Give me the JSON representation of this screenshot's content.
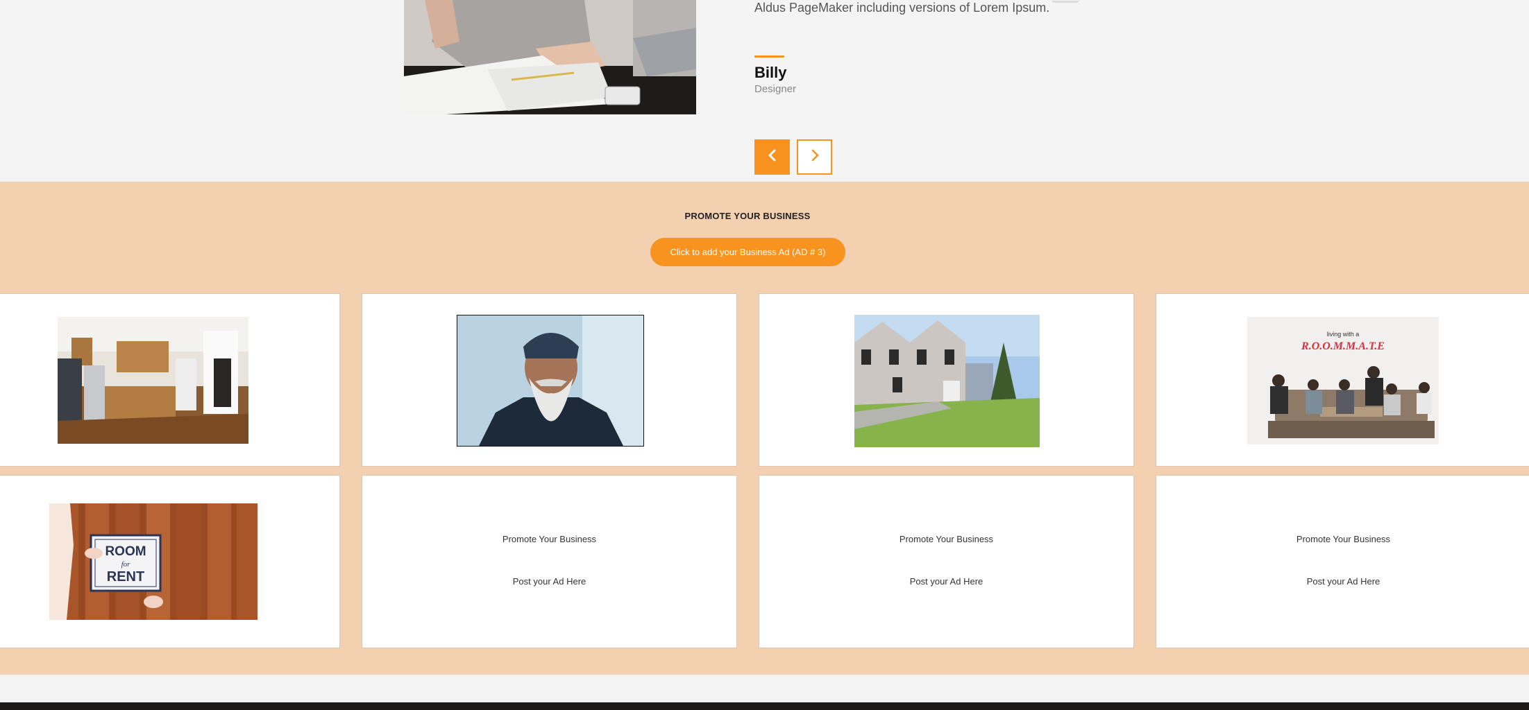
{
  "testimonial": {
    "quote": "Aldus PageMaker including versions of Lorem Ipsum.",
    "name": "Billy",
    "role": "Designer"
  },
  "promo": {
    "title": "PROMOTE YOUR BUSINESS",
    "cta_label": "Click to add your Business Ad (AD # 3)",
    "roommate_image_heading": "living with a",
    "roommate_image_title": "R.O.O.M.M.A.T.E",
    "rent_sign_line1": "ROOM",
    "rent_sign_line2": "for",
    "rent_sign_line3": "RENT",
    "placeholder_cards": [
      {
        "line1": "Promote Your Business",
        "line2": "Post your Ad Here"
      },
      {
        "line1": "Promote Your Business",
        "line2": "Post your Ad Here"
      },
      {
        "line1": "Promote Your Business",
        "line2": "Post your Ad Here"
      }
    ]
  },
  "colors": {
    "accent": "#f7931e",
    "promo_bg": "#f2d0b0",
    "page_bg": "#f4f4f4",
    "footer_bg": "#1d1b1a"
  },
  "icons": {
    "prev": "chevron-left-icon",
    "next": "chevron-right-icon"
  }
}
